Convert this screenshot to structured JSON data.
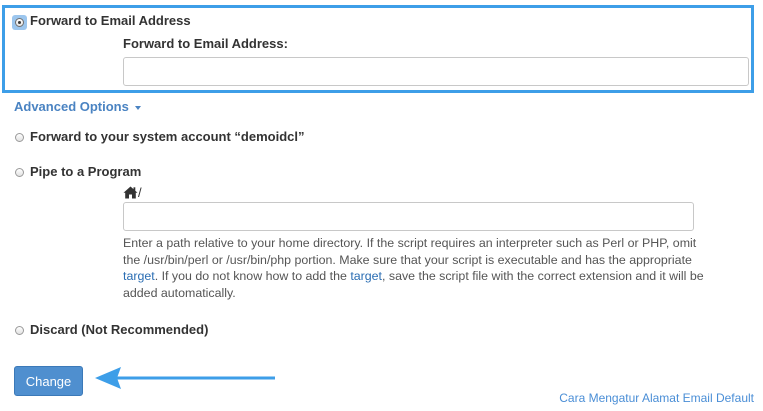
{
  "forward_email": {
    "option_label": "Forward to Email Address",
    "field_label": "Forward to Email Address:",
    "value": "",
    "selected": true
  },
  "advanced_options": {
    "label": "Advanced Options"
  },
  "forward_system": {
    "option_label": "Forward to your system account “demoidcl”"
  },
  "pipe": {
    "option_label": "Pipe to a Program",
    "path_prefix": "/",
    "value": "",
    "help_part1": "Enter a path relative to your home directory. If the script requires an interpreter such as Perl or PHP, omit the /usr/bin/perl or /usr/bin/php portion. Make sure that your script is executable and has the appropriate ",
    "help_link1": "target",
    "help_part2": ". If you do not know how to add the ",
    "help_link2": "target",
    "help_part3": ", save the script file with the correct extension and it will be added automatically."
  },
  "discard": {
    "option_label": "Discard (Not Recommended)"
  },
  "change_button": {
    "label": "Change"
  },
  "footer_link": {
    "label": "Cara Mengatur Alamat Email Default"
  },
  "colors": {
    "highlight": "#3d9ee8",
    "button": "#4f8fcf",
    "link": "#4a83c2"
  },
  "icons": {
    "home": "home-icon",
    "arrow": "arrow-left-icon",
    "caret": "caret-down-icon"
  }
}
